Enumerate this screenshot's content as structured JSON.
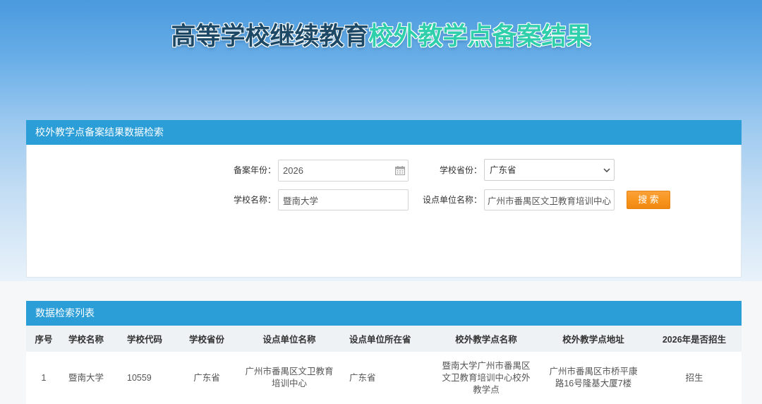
{
  "page": {
    "title_part1": "高等学校继续教育",
    "title_part2": "校外教学点备案结果"
  },
  "search_panel": {
    "header": "校外教学点备案结果数据检索",
    "fields": {
      "year": {
        "label": "备案年份：",
        "value": "2026"
      },
      "province": {
        "label": "学校省份：",
        "selected": "广东省"
      },
      "school_name": {
        "label": "学校名称：",
        "value": "暨南大学"
      },
      "unit_name": {
        "label": "设点单位名称：",
        "value": "广州市番禺区文卫教育培训中心"
      }
    },
    "search_button": "搜 索"
  },
  "results_panel": {
    "header": "数据检索列表",
    "columns": [
      "序号",
      "学校名称",
      "学校代码",
      "学校省份",
      "设点单位名称",
      "设点单位所在省",
      "校外教学点名称",
      "校外教学点地址",
      "2026年是否招生"
    ],
    "rows": [
      {
        "index": "1",
        "school_name": "暨南大学",
        "school_code": "10559",
        "school_province": "广东省",
        "unit_name": "广州市番禺区文卫教育培训中心",
        "unit_province": "广东省",
        "site_name": "暨南大学广州市番禺区文卫教育培训中心校外教学点",
        "site_address": "广州市番禺区市桥平康路16号隆基大厦7楼",
        "enrollment": "招生"
      }
    ]
  },
  "colors": {
    "panel_header": "#2b9ed8",
    "search_button": "#f7941d",
    "title_main": "#1d4966",
    "title_accent": "#2fcfab"
  },
  "icons": {
    "year_picker": "calendar-icon",
    "province_dropdown": "chevron-down-icon"
  }
}
